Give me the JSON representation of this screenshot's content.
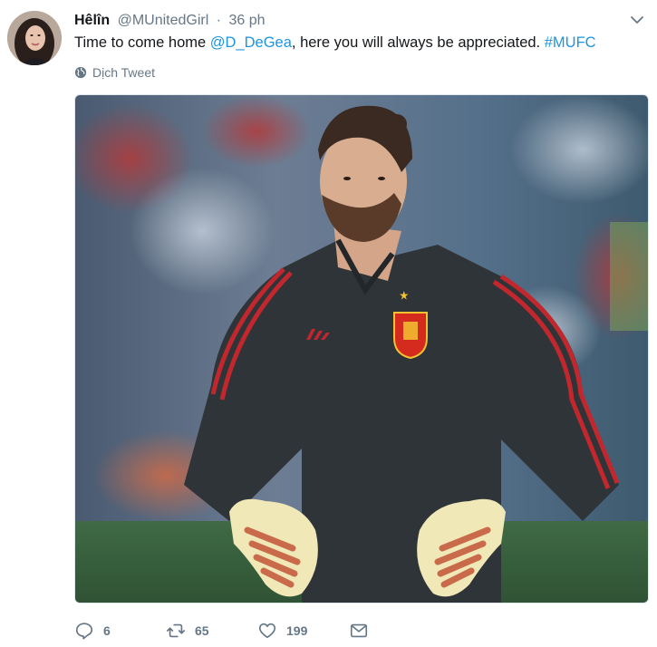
{
  "tweet": {
    "display_name": "Hêlîn",
    "handle": "@MUnitedGirl",
    "separator": "·",
    "timestamp": "36 ph",
    "text_prefix": "Time to come home ",
    "mention": "@D_DeGea",
    "text_middle": ", here you will always be appreciated. ",
    "hashtag": "#MUFC",
    "translate_label": "Dịch Tweet",
    "link_color": "#1b95e0",
    "meta_color": "#657786"
  },
  "icons": {
    "caret": "chevron-down-icon",
    "translate": "globe-icon",
    "reply": "reply-icon",
    "retweet": "retweet-icon",
    "like": "heart-icon",
    "message": "envelope-icon"
  },
  "actions": {
    "reply_count": "6",
    "retweet_count": "65",
    "like_count": "199"
  }
}
